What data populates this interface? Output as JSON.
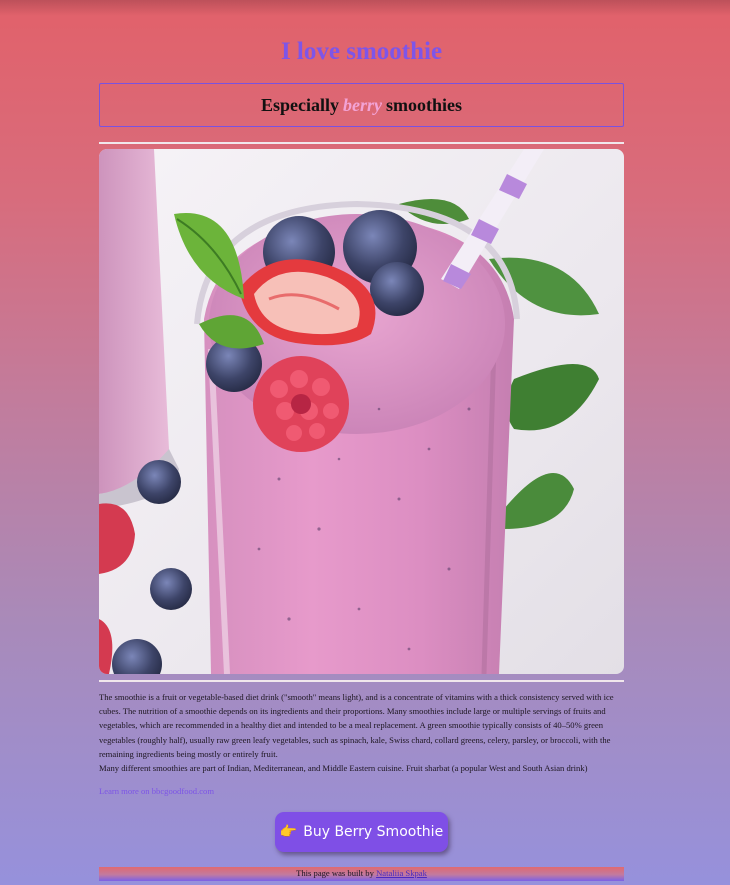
{
  "header": {
    "title": "I love smoothie"
  },
  "subtitle": {
    "prefix": "Especially",
    "highlight": "berry",
    "suffix": "smoothies"
  },
  "hero_image": {
    "subject": "berry smoothie glass with straw, strawberry, raspberry, blueberries and mint"
  },
  "description": {
    "paragraph1": "The smoothie is a fruit or vegetable-based diet drink (\"smooth\" means light), and is a concentrate of vitamins with a thick consistency served with ice cubes. The nutrition of a smoothie depends on its ingredients and their proportions. Many smoothies include large or multiple servings of fruits and vegetables, which are recommended in a healthy diet and intended to be a meal replacement. A green smoothie typically consists of 40–50% green vegetables (roughly half), usually raw green leafy vegetables, such as spinach, kale, Swiss chard, collard greens, celery, parsley, or broccoli, with the remaining ingredients being mostly or entirely fruit.",
    "paragraph2": "Many different smoothies are part of Indian, Mediterranean, and Middle Eastern cuisine. Fruit sharbat (a popular West and South Asian drink)"
  },
  "learn_more": {
    "label": "Learn more on bbcgoodfood.com"
  },
  "buy_button": {
    "icon": "pointing-hand-icon",
    "label": "Buy Berry Smoothie"
  },
  "footer": {
    "prefix": "This page was built by",
    "author": "Nataliia Skpak"
  },
  "colors": {
    "title": "#7e55e8",
    "accent": "#7f4fe6",
    "highlight": "#f3a3d6",
    "bg_top": "#e2616a",
    "bg_bottom": "#9691dc"
  }
}
